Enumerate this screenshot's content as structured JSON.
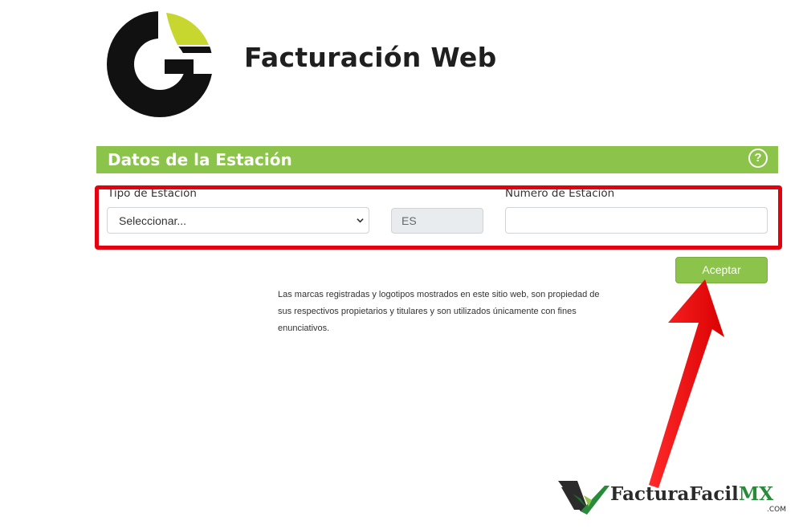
{
  "header": {
    "title": "Facturación Web"
  },
  "section": {
    "title": "Datos de la Estación",
    "help_symbol": "?"
  },
  "form": {
    "tipo_label": "Tipo de Estación",
    "tipo_value": "Seleccionar...",
    "prefix_value": "ES",
    "numero_label": "Número de Estación",
    "numero_value": ""
  },
  "actions": {
    "accept_label": "Aceptar"
  },
  "disclaimer": "Las marcas registradas y logotipos mostrados en este sitio web, son propiedad de sus respectivos propietarios y titulares y son utilizados únicamente con fines enunciativos.",
  "watermark": {
    "main": "FacturaFacil",
    "accent": "MX",
    "suffix": ".COM"
  },
  "colors": {
    "brand_green": "#8cc34b",
    "logo_lime": "#c8d730",
    "highlight_red": "#e3000f",
    "watermark_green": "#2a8a3c"
  },
  "icons": {
    "help": "question-circle-icon",
    "select_chevron": "chevron-down-icon",
    "arrow": "red-arrow-annotation"
  }
}
